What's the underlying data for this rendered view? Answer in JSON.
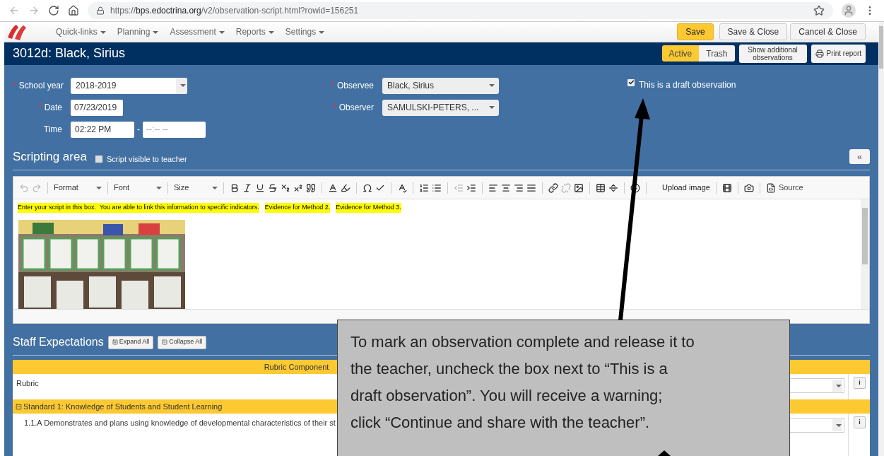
{
  "browser": {
    "url_scheme": "https://",
    "url_host": "bps.edoctrina.org",
    "url_path": "/v2/observation-script.html?rowid=156251"
  },
  "nav": {
    "menus": [
      "Quick-links",
      "Planning",
      "Assessment",
      "Reports",
      "Settings"
    ],
    "buttons": [
      {
        "label": "Save",
        "kind": "primary"
      },
      {
        "label": "Save & Close",
        "kind": "default"
      },
      {
        "label": "Cancel & Close",
        "kind": "default"
      }
    ]
  },
  "title": "3012d: Black, Sirius",
  "status_toggle": [
    {
      "label": "Active",
      "selected": true
    },
    {
      "label": "Trash",
      "selected": false
    }
  ],
  "title_buttons": [
    {
      "label": "Show additional observations",
      "kind": "text"
    },
    {
      "label": "Print report",
      "kind": "print"
    }
  ],
  "form": {
    "left": [
      {
        "label": "School year",
        "required": true,
        "kind": "select",
        "value": "2018-2019"
      },
      {
        "label": "Date",
        "required": true,
        "kind": "input",
        "value": "07/23/2019"
      },
      {
        "label": "Time",
        "required": false,
        "kind": "time",
        "value": "02:22 PM",
        "end_value": "--:-- --",
        "separator": "-"
      }
    ],
    "right": [
      {
        "label": "Observee",
        "required": true,
        "kind": "select",
        "value": "Black, Sirius"
      },
      {
        "label": "Observer",
        "required": true,
        "kind": "select",
        "value": "SAMULSKI-PETERS, ..."
      }
    ],
    "required_mark": "*",
    "draft": {
      "label": "This is a draft observation",
      "checked": true
    }
  },
  "scripting": {
    "title": "Scripting area",
    "visible": {
      "label": "Script visible to teacher",
      "checked": false
    },
    "collapse": "«",
    "toolbar": {
      "dropdowns": [
        "Format",
        "Font",
        "Size"
      ],
      "upload": "Upload image",
      "source": "Source"
    },
    "highlights": [
      "Enter your script in this box.  You are able to link this information to specific indicators.",
      "Evidence for Method 2.",
      "Evidence for Method 3."
    ],
    "photo": {
      "kind": "picture"
    }
  },
  "staff": {
    "title": "Staff Expectations",
    "buttons": [
      {
        "label": "Expand All",
        "kind": "expand"
      },
      {
        "label": "Collapse All",
        "kind": "collapse"
      }
    ],
    "column": "Rubric Component",
    "rows": [
      {
        "kind": "rubric",
        "text": "Rubric",
        "info": "i"
      },
      {
        "kind": "standard",
        "text": "Standard 1: Knowledge of Students and Student Learning",
        "expanded": true
      },
      {
        "kind": "indicator",
        "text": "1.1.A Demonstrates and plans using knowledge of developmental characteristics of their st",
        "info": "i"
      }
    ]
  },
  "callout": {
    "lines": [
      "To mark an observation complete and release it to",
      "the teacher, uncheck the box next to “This is a",
      "draft observation”.  You will receive a warning;",
      "click “Continue and share with the teacher”."
    ]
  }
}
